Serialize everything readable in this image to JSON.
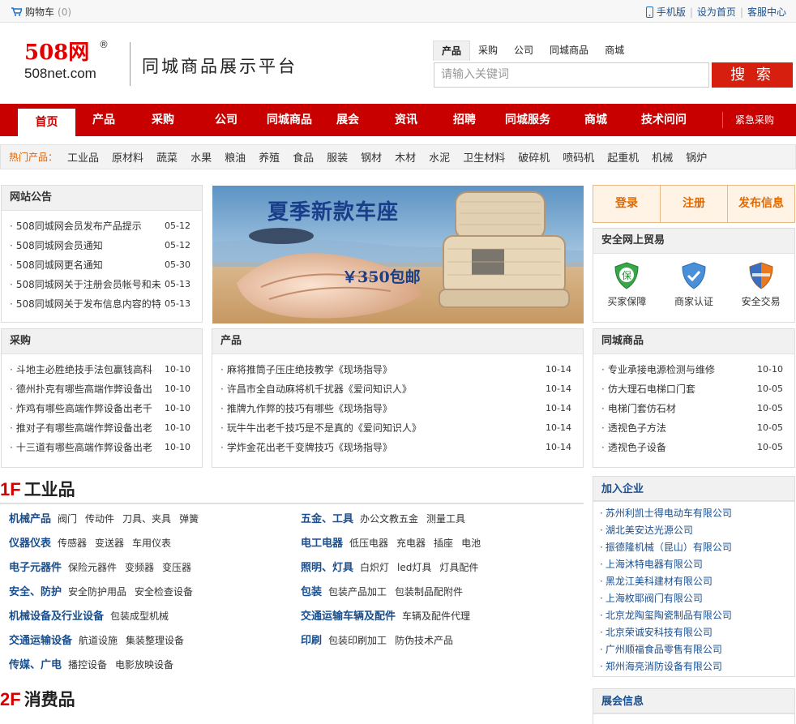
{
  "topbar": {
    "cart_label": "购物车",
    "cart_count": "(0)",
    "links": [
      "手机版",
      "设为首页",
      "客服中心"
    ]
  },
  "header": {
    "logo_main": "508网",
    "logo_reg": "®",
    "logo_sub": "508net.com",
    "slogan": "同城商品展示平台",
    "search_tabs": [
      "产品",
      "采购",
      "公司",
      "同城商品",
      "商城"
    ],
    "search_placeholder": "请输入关键词",
    "search_button": "搜 索"
  },
  "nav": {
    "items": [
      "首页",
      "产品",
      "采购",
      "公司",
      "同城商品",
      "展会",
      "资讯",
      "招聘",
      "同城服务",
      "商城",
      "技术问问"
    ],
    "urgent": "紧急采购"
  },
  "hot": {
    "label": "热门产品：",
    "items": [
      "工业品",
      "原材料",
      "蔬菜",
      "水果",
      "粮油",
      "养殖",
      "食品",
      "服装",
      "钢材",
      "木材",
      "水泥",
      "卫生材料",
      "破碎机",
      "喷码机",
      "起重机",
      "机械",
      "锅炉"
    ]
  },
  "notice": {
    "title": "网站公告",
    "items": [
      {
        "text": "508同城网会员发布产品提示",
        "date": "05-12"
      },
      {
        "text": "508同城网会员通知",
        "date": "05-12"
      },
      {
        "text": "508同城网更名通知",
        "date": "05-30"
      },
      {
        "text": "508同城网关于注册会员帐号和未",
        "date": "05-13"
      },
      {
        "text": "508同城网关于发布信息内容的特",
        "date": "05-13"
      }
    ]
  },
  "banner": {
    "headline": "夏季新款车座",
    "price": "￥350包邮"
  },
  "auth": {
    "buttons": [
      "登录",
      "注册",
      "发布信息"
    ]
  },
  "secure": {
    "title": "安全网上贸易",
    "items": [
      {
        "label": "买家保障",
        "icon": "shield-guarantee-icon",
        "badge": "保"
      },
      {
        "label": "商家认证",
        "icon": "shield-check-icon"
      },
      {
        "label": "安全交易",
        "icon": "shield-secure-icon"
      }
    ]
  },
  "purchase": {
    "title": "采购",
    "items": [
      {
        "text": "斗地主必胜绝技手法包赢钱高科",
        "date": "10-10"
      },
      {
        "text": "德州扑克有哪些高端作弊设备出",
        "date": "10-10"
      },
      {
        "text": "炸鸡有哪些高端作弊设备出老千",
        "date": "10-10"
      },
      {
        "text": "推对子有哪些高端作弊设备出老",
        "date": "10-10"
      },
      {
        "text": "十三道有哪些高端作弊设备出老",
        "date": "10-10"
      }
    ]
  },
  "products": {
    "title": "产品",
    "items": [
      {
        "text": "麻将推筒子压庄绝技教学《现场指导》",
        "date": "10-14"
      },
      {
        "text": "许昌市全自动麻将机千扰器《爱问知识人》",
        "date": "10-14"
      },
      {
        "text": "推牌九作弊的技巧有哪些《现场指导》",
        "date": "10-14"
      },
      {
        "text": "玩牛牛出老千技巧是不是真的《爱问知识人》",
        "date": "10-14"
      },
      {
        "text": "学炸金花出老千变牌技巧《现场指导》",
        "date": "10-14"
      }
    ]
  },
  "local": {
    "title": "同城商品",
    "items": [
      {
        "text": "专业承接电源检测与维修",
        "date": "10-10"
      },
      {
        "text": "仿大理石电梯口门套",
        "date": "10-05"
      },
      {
        "text": "电梯门套仿石材",
        "date": "10-05"
      },
      {
        "text": "透视色子方法",
        "date": "10-05"
      },
      {
        "text": "透视色子设备",
        "date": "10-05"
      }
    ]
  },
  "floor1": {
    "num": "1F",
    "title": "工业品",
    "left": [
      {
        "head": "机械产品",
        "subs": [
          "阀门",
          "传动件",
          "刀具、夹具",
          "弹簧"
        ]
      },
      {
        "head": "仪器仪表",
        "subs": [
          "传感器",
          "变送器",
          "车用仪表"
        ]
      },
      {
        "head": "电子元器件",
        "subs": [
          "保险元器件",
          "变频器",
          "变压器"
        ]
      },
      {
        "head": "安全、防护",
        "subs": [
          "安全防护用品",
          "安全检查设备"
        ]
      },
      {
        "head": "机械设备及行业设备",
        "subs": [
          "包装成型机械"
        ]
      },
      {
        "head": "交通运输设备",
        "subs": [
          "航道设施",
          "集装整理设备"
        ]
      },
      {
        "head": "传媒、广电",
        "subs": [
          "播控设备",
          "电影放映设备"
        ]
      }
    ],
    "right": [
      {
        "head": "五金、工具",
        "subs": [
          "办公文教五金",
          "测量工具"
        ]
      },
      {
        "head": "电工电器",
        "subs": [
          "低压电器",
          "充电器",
          "插座",
          "电池"
        ]
      },
      {
        "head": "照明、灯具",
        "subs": [
          "白炽灯",
          "led灯具",
          "灯具配件"
        ]
      },
      {
        "head": "包装",
        "subs": [
          "包装产品加工",
          "包装制品配附件"
        ]
      },
      {
        "head": "交通运输车辆及配件",
        "subs": [
          "车辆及配件代理"
        ]
      },
      {
        "head": "印刷",
        "subs": [
          "包装印刷加工",
          "防伪技术产品"
        ]
      }
    ]
  },
  "floor2": {
    "num": "2F",
    "title": "消费品"
  },
  "companies": {
    "title": "加入企业",
    "items": [
      "苏州利凯士得电动车有限公司",
      "湖北美安达光源公司",
      "振德隆机械（昆山）有限公司",
      "上海沐特电器有限公司",
      "黑龙江美科建材有限公司",
      "上海枚耶阀门有限公司",
      "北京龙陶玺陶瓷制品有限公司",
      "北京荣诚安科技有限公司",
      "广州顺福食品零售有限公司",
      "郑州海亮消防设备有限公司"
    ]
  },
  "expo": {
    "title": "展会信息"
  },
  "colors": {
    "brand_red": "#c90000",
    "link_blue": "#1a4f8f",
    "accent_orange": "#e06a00"
  }
}
